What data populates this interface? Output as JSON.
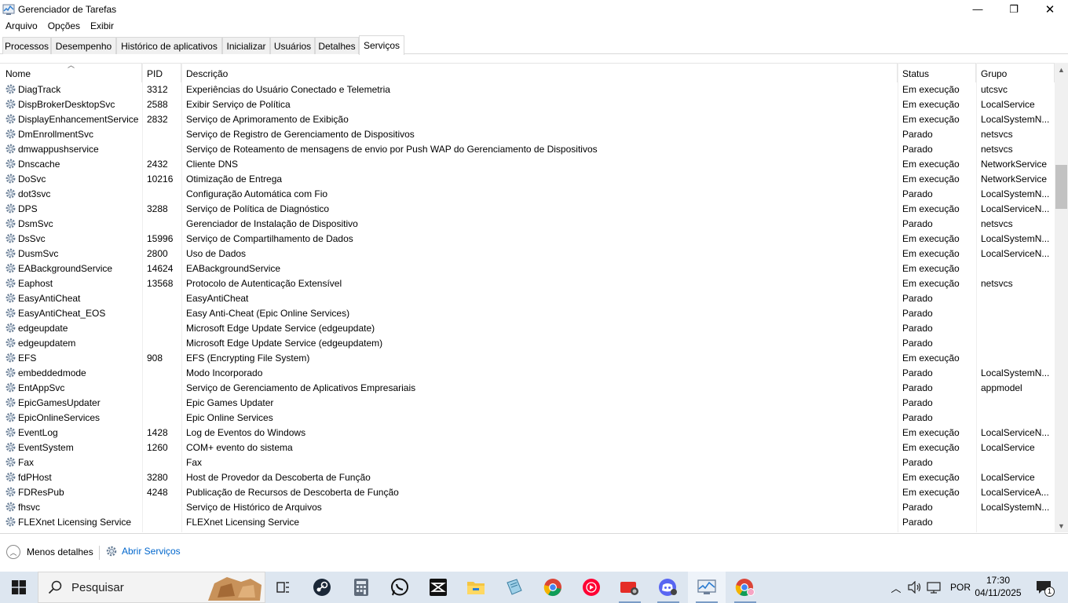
{
  "window": {
    "title": "Gerenciador de Tarefas",
    "minimize_glyph": "—",
    "maximize_glyph": "❐",
    "close_glyph": "✕"
  },
  "menu": [
    "Arquivo",
    "Opções",
    "Exibir"
  ],
  "tabs": [
    {
      "label": "Processos",
      "active": false
    },
    {
      "label": "Desempenho",
      "active": false
    },
    {
      "label": "Histórico de aplicativos",
      "active": false
    },
    {
      "label": "Inicializar",
      "active": false
    },
    {
      "label": "Usuários",
      "active": false
    },
    {
      "label": "Detalhes",
      "active": false
    },
    {
      "label": "Serviços",
      "active": true
    }
  ],
  "columns": {
    "name": "Nome",
    "pid": "PID",
    "description": "Descrição",
    "status": "Status",
    "group": "Grupo"
  },
  "services": [
    {
      "name": "DiagTrack",
      "pid": "3312",
      "description": "Experiências do Usuário Conectado e Telemetria",
      "status": "Em execução",
      "group": "utcsvc"
    },
    {
      "name": "DispBrokerDesktopSvc",
      "pid": "2588",
      "description": "Exibir Serviço de Política",
      "status": "Em execução",
      "group": "LocalService"
    },
    {
      "name": "DisplayEnhancementService",
      "pid": "2832",
      "description": "Serviço de Aprimoramento de Exibição",
      "status": "Em execução",
      "group": "LocalSystemN..."
    },
    {
      "name": "DmEnrollmentSvc",
      "pid": "",
      "description": "Serviço de Registro de Gerenciamento de Dispositivos",
      "status": "Parado",
      "group": "netsvcs"
    },
    {
      "name": "dmwappushservice",
      "pid": "",
      "description": "Serviço de Roteamento de mensagens de envio por Push WAP do Gerenciamento de Dispositivos",
      "status": "Parado",
      "group": "netsvcs"
    },
    {
      "name": "Dnscache",
      "pid": "2432",
      "description": "Cliente DNS",
      "status": "Em execução",
      "group": "NetworkService"
    },
    {
      "name": "DoSvc",
      "pid": "10216",
      "description": "Otimização de Entrega",
      "status": "Em execução",
      "group": "NetworkService"
    },
    {
      "name": "dot3svc",
      "pid": "",
      "description": "Configuração Automática com Fio",
      "status": "Parado",
      "group": "LocalSystemN..."
    },
    {
      "name": "DPS",
      "pid": "3288",
      "description": "Serviço de Política de Diagnóstico",
      "status": "Em execução",
      "group": "LocalServiceN..."
    },
    {
      "name": "DsmSvc",
      "pid": "",
      "description": "Gerenciador de Instalação de Dispositivo",
      "status": "Parado",
      "group": "netsvcs"
    },
    {
      "name": "DsSvc",
      "pid": "15996",
      "description": "Serviço de Compartilhamento de Dados",
      "status": "Em execução",
      "group": "LocalSystemN..."
    },
    {
      "name": "DusmSvc",
      "pid": "2800",
      "description": "Uso de Dados",
      "status": "Em execução",
      "group": "LocalServiceN..."
    },
    {
      "name": "EABackgroundService",
      "pid": "14624",
      "description": "EABackgroundService",
      "status": "Em execução",
      "group": ""
    },
    {
      "name": "Eaphost",
      "pid": "13568",
      "description": "Protocolo de Autenticação Extensível",
      "status": "Em execução",
      "group": "netsvcs"
    },
    {
      "name": "EasyAntiCheat",
      "pid": "",
      "description": "EasyAntiCheat",
      "status": "Parado",
      "group": ""
    },
    {
      "name": "EasyAntiCheat_EOS",
      "pid": "",
      "description": "Easy Anti-Cheat (Epic Online Services)",
      "status": "Parado",
      "group": ""
    },
    {
      "name": "edgeupdate",
      "pid": "",
      "description": "Microsoft Edge Update Service (edgeupdate)",
      "status": "Parado",
      "group": ""
    },
    {
      "name": "edgeupdatem",
      "pid": "",
      "description": "Microsoft Edge Update Service (edgeupdatem)",
      "status": "Parado",
      "group": ""
    },
    {
      "name": "EFS",
      "pid": "908",
      "description": "EFS (Encrypting File System)",
      "status": "Em execução",
      "group": ""
    },
    {
      "name": "embeddedmode",
      "pid": "",
      "description": "Modo Incorporado",
      "status": "Parado",
      "group": "LocalSystemN..."
    },
    {
      "name": "EntAppSvc",
      "pid": "",
      "description": "Serviço de Gerenciamento de Aplicativos Empresariais",
      "status": "Parado",
      "group": "appmodel"
    },
    {
      "name": "EpicGamesUpdater",
      "pid": "",
      "description": "Epic Games Updater",
      "status": "Parado",
      "group": ""
    },
    {
      "name": "EpicOnlineServices",
      "pid": "",
      "description": "Epic Online Services",
      "status": "Parado",
      "group": ""
    },
    {
      "name": "EventLog",
      "pid": "1428",
      "description": "Log de Eventos do Windows",
      "status": "Em execução",
      "group": "LocalServiceN..."
    },
    {
      "name": "EventSystem",
      "pid": "1260",
      "description": "COM+ evento do sistema",
      "status": "Em execução",
      "group": "LocalService"
    },
    {
      "name": "Fax",
      "pid": "",
      "description": "Fax",
      "status": "Parado",
      "group": ""
    },
    {
      "name": "fdPHost",
      "pid": "3280",
      "description": "Host de Provedor da Descoberta de Função",
      "status": "Em execução",
      "group": "LocalService"
    },
    {
      "name": "FDResPub",
      "pid": "4248",
      "description": "Publicação de Recursos de Descoberta de Função",
      "status": "Em execução",
      "group": "LocalServiceA..."
    },
    {
      "name": "fhsvc",
      "pid": "",
      "description": "Serviço de Histórico de Arquivos",
      "status": "Parado",
      "group": "LocalSystemN..."
    },
    {
      "name": "FLEXnet Licensing Service",
      "pid": "",
      "description": "FLEXnet Licensing Service",
      "status": "Parado",
      "group": ""
    }
  ],
  "footer": {
    "less_details": "Menos detalhes",
    "open_services": "Abrir Serviços"
  },
  "taskbar": {
    "search_placeholder": "Pesquisar",
    "apps": [
      "task-view-icon",
      "steam-icon",
      "calculator-icon",
      "whatsapp-icon",
      "capcut-icon",
      "file-explorer-icon",
      "notepad-icon",
      "chrome-icon",
      "youtube-music-icon",
      "camera-app-icon",
      "discord-icon",
      "task-manager-icon",
      "chrome-profile-icon"
    ],
    "language": "POR",
    "time": "17:30",
    "date": "04/11/2025",
    "notification_count": "1"
  },
  "colors": {
    "link": "#0066cc",
    "taskbar": "#dde6f0",
    "tab_border": "#d9d9d9"
  }
}
